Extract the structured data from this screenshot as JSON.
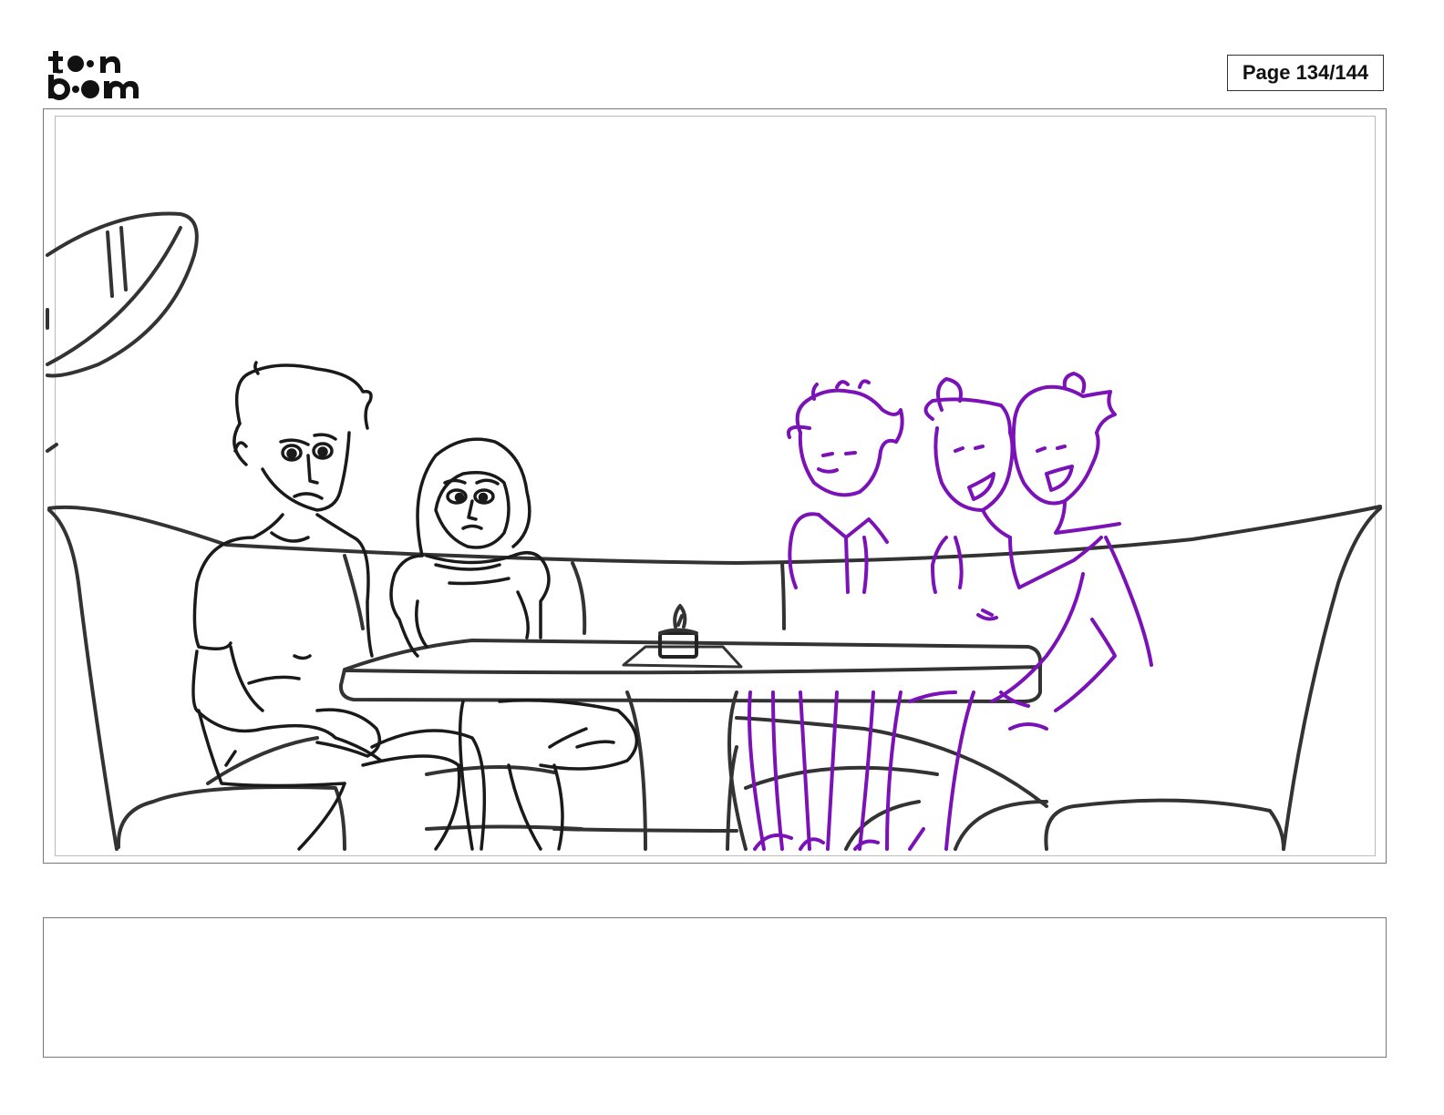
{
  "header": {
    "logo_line1": "toon",
    "logo_line2": "boom",
    "page_label": "Page 134/144"
  },
  "panel": {
    "sketch_colors": {
      "ink": "#1a1a1a",
      "furniture": "#333333",
      "rough": "#7a12b8"
    }
  },
  "caption": {
    "text": ""
  }
}
